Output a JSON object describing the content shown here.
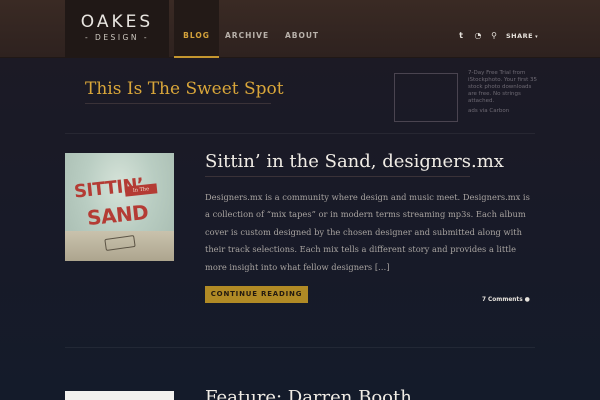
{
  "header": {
    "logo_main": "OAKES",
    "logo_sub": "- DESIGN -",
    "nav": [
      {
        "label": "BLOG",
        "active": true
      },
      {
        "label": "ARCHIVE",
        "active": false
      },
      {
        "label": "ABOUT",
        "active": false
      }
    ],
    "icons": [
      "twitter-icon",
      "rss-icon",
      "search-icon"
    ],
    "icon_glyphs": {
      "twitter": "t",
      "rss": "◔",
      "search": "⚲"
    },
    "share_label": "SHARE",
    "share_caret": "▾"
  },
  "sweet_spot": {
    "title": "This Is The Sweet Spot",
    "ad_text": "7-Day Free Trial from iStockphoto. Your first 35 stock photo downloads are free. No strings attached.",
    "ad_via": "ads via Carbon"
  },
  "posts": [
    {
      "title": "Sittin’ in the Sand, designers.mx",
      "thumbnail_words": [
        "SITTIN’",
        "SAND"
      ],
      "thumbnail_tag": "In The",
      "excerpt": "Designers.mx is a community where design and music meet. Designers.mx is a collection of “mix tapes” or in modern terms streaming mp3s. Each album cover is custom designed by the chosen designer and submitted along with their track selections. Each mix tells a different story and provides a little more insight into what fellow designers […]",
      "continue_label": "CONTINUE READING",
      "comments_label": "7 Comments",
      "comments_glyph": "●"
    },
    {
      "title": "Feature: Darren Booth"
    }
  ],
  "colors": {
    "accent": "#d9a63a",
    "button": "#b08a25",
    "header_bg": "#3a2a24",
    "page_bg": "#191a27"
  }
}
